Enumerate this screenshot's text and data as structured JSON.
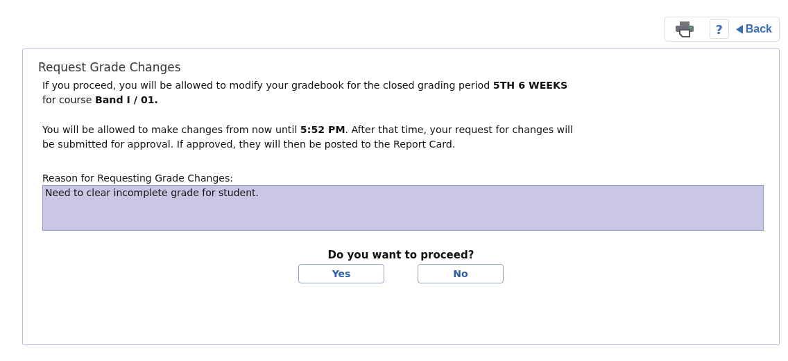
{
  "toolbar": {
    "help_label": "?",
    "back_label": "Back"
  },
  "panel": {
    "title": "Request Grade Changes",
    "paragraphs": [
      "If you proceed, you will be allowed to modify your gradebook for the closed grading period **5TH 6 WEEKS**\nfor course **Band I / 01.**",
      "You will be allowed to make changes from now until **5:52 PM**. After that time, your request for changes will\nbe submitted for approval. If approved, they will then be posted to the Report Card."
    ],
    "reason_label": "Reason for Requesting Grade Changes:",
    "reason_value": "Need to clear incomplete grade for student.",
    "question": "Do you want to proceed?",
    "buttons": [
      "Yes",
      "No"
    ]
  }
}
